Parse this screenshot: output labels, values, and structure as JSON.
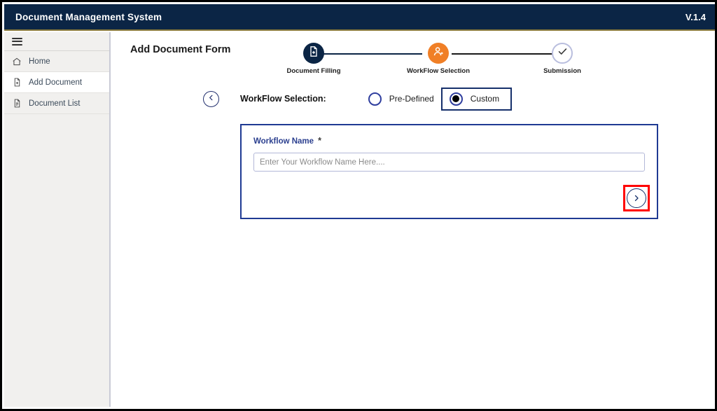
{
  "header": {
    "title": "Document Management System",
    "version": "V.1.4"
  },
  "sidebar": {
    "menu_icon": "hamburger-icon",
    "items": [
      {
        "label": "Home",
        "icon": "home-icon",
        "active": false
      },
      {
        "label": "Add Document",
        "icon": "file-plus-icon",
        "active": true
      },
      {
        "label": "Document List",
        "icon": "document-list-icon",
        "active": false
      }
    ]
  },
  "main": {
    "page_title": "Add Document Form",
    "stepper": {
      "steps": [
        {
          "label": "Document Filling",
          "state": "done",
          "icon": "file-plus-icon"
        },
        {
          "label": "WorkFlow Selection",
          "state": "current",
          "icon": "user-plus-icon"
        },
        {
          "label": "Submission",
          "state": "todo",
          "icon": "check-icon"
        }
      ]
    },
    "selector": {
      "back_icon": "chevron-left-icon",
      "label": "WorkFlow Selection:",
      "options": [
        {
          "label": "Pre-Defined",
          "selected": false
        },
        {
          "label": "Custom",
          "selected": true
        }
      ]
    },
    "form": {
      "field_label": "Workflow Name",
      "required_marker": "*",
      "input_value": "",
      "input_placeholder": "Enter Your Workflow Name Here....",
      "next_icon": "chevron-right-icon"
    }
  },
  "colors": {
    "header_navy": "#0b2545",
    "header_accent": "#8a7a3c",
    "step_current_orange": "#f07f26",
    "panel_border_blue": "#1f3a93",
    "highlight_red": "#ff0000",
    "sidebar_bg": "#f1f0ee"
  }
}
